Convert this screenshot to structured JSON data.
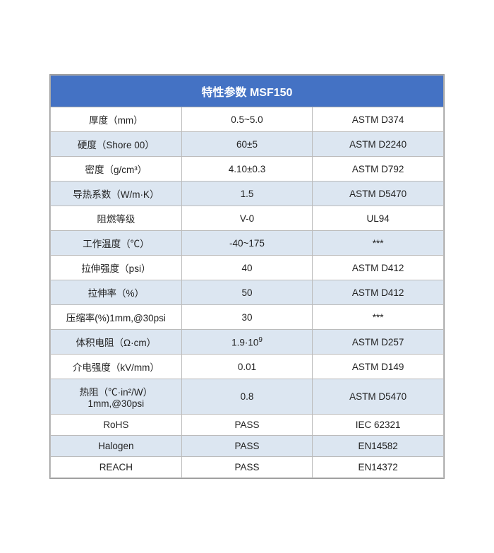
{
  "table": {
    "title": "特性参数 MSF150",
    "columns": [
      "property",
      "value",
      "standard"
    ],
    "rows": [
      {
        "property": "厚度（mm）",
        "value": "0.5~5.0",
        "standard": "ASTM D374"
      },
      {
        "property": "硬度（Shore 00）",
        "value": "60±5",
        "standard": "ASTM D2240"
      },
      {
        "property": "密度（g/cm³）",
        "value": "4.10±0.3",
        "standard": "ASTM D792"
      },
      {
        "property": "导热系数（W/m·K）",
        "value": "1.5",
        "standard": "ASTM D5470"
      },
      {
        "property": "阻燃等级",
        "value": "V-0",
        "standard": "UL94"
      },
      {
        "property": "工作温度（℃）",
        "value": "-40~175",
        "standard": "***"
      },
      {
        "property": "拉伸强度（psi）",
        "value": "40",
        "standard": "ASTM D412"
      },
      {
        "property": "拉伸率（%）",
        "value": "50",
        "standard": "ASTM D412"
      },
      {
        "property": "压缩率(%)1mm,@30psi",
        "value": "30",
        "standard": "***"
      },
      {
        "property": "体积电阻（Ω·cm）",
        "value": "1.9·10⁹",
        "standard": "ASTM D257"
      },
      {
        "property": "介电强度（kV/mm）",
        "value": "0.01",
        "standard": "ASTM D149"
      },
      {
        "property": "热阻（℃·in²/W）1mm,@30psi",
        "value": "0.8",
        "standard": "ASTM D5470"
      },
      {
        "property": "RoHS",
        "value": "PASS",
        "standard": "IEC 62321"
      },
      {
        "property": "Halogen",
        "value": "PASS",
        "standard": "EN14582"
      },
      {
        "property": "REACH",
        "value": "PASS",
        "standard": "EN14372"
      }
    ]
  }
}
